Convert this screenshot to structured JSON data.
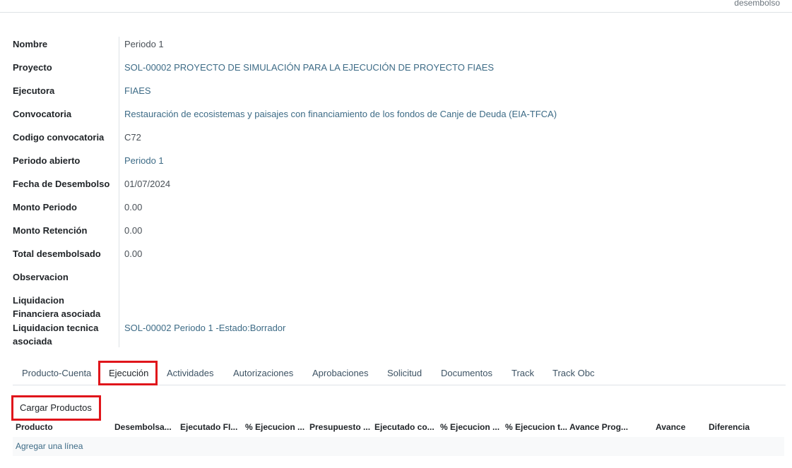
{
  "header": {
    "status_text": "desembolso"
  },
  "fields": [
    {
      "label": "Nombre",
      "value": "Periodo 1"
    },
    {
      "label": "Proyecto",
      "value": "SOL-00002 PROYECTO DE SIMULACIÓN PARA LA EJECUCIÓN DE PROYECTO FIAES"
    },
    {
      "label": "Ejecutora",
      "value": "FIAES"
    },
    {
      "label": "Convocatoria",
      "value": "Restauración de ecosistemas y paisajes con financiamiento de los fondos de Canje de Deuda (EIA-TFCA)"
    },
    {
      "label": "Codigo convocatoria",
      "value": "C72"
    },
    {
      "label": "Periodo abierto",
      "value": "Periodo 1"
    },
    {
      "label": "Fecha de Desembolso",
      "value": "01/07/2024"
    },
    {
      "label": "Monto Periodo",
      "value": "0.00"
    },
    {
      "label": "Monto Retención",
      "value": "0.00"
    },
    {
      "label": "Total desembolsado",
      "value": "0.00"
    },
    {
      "label": "Observacion",
      "value": ""
    },
    {
      "label": "Liquidacion Financiera asociada",
      "value": ""
    },
    {
      "label": "Liquidacion tecnica asociada",
      "value": "SOL-00002 Periodo 1 -Estado:Borrador"
    }
  ],
  "tabs": [
    "Producto-Cuenta",
    "Ejecución",
    "Actividades",
    "Autorizaciones",
    "Aprobaciones",
    "Solicitud",
    "Documentos",
    "Track",
    "Track Obc"
  ],
  "active_tab": "Ejecución",
  "ejecucion": {
    "load_button": "Cargar Productos",
    "columns": [
      "Producto",
      "Desembolsa...",
      "Ejecutado FI...",
      "% Ejecucion ...",
      "Presupuesto ...",
      "Ejecutado co...",
      "% Ejecucion ...",
      "% Ejecucion t...",
      "Avance Prog...",
      "Avance",
      "Diferencia"
    ],
    "add_line": "Agregar una línea"
  },
  "highlight_color": "#e0151b"
}
